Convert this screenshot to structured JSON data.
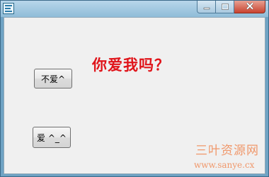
{
  "window": {
    "controls": {
      "minimize_icon": "minimize-icon",
      "maximize_icon": "maximize-icon",
      "close_icon": "close-icon"
    }
  },
  "main": {
    "question": "你爱我吗？",
    "no_button_label": "不爱^",
    "yes_button_label": "爱 ^_^"
  },
  "watermark": {
    "site_name": "三叶资源网",
    "url": "www.sanye.cx"
  },
  "colors": {
    "question": "#e0141a",
    "watermark": "#f0976a",
    "close_button": "#c8432f"
  }
}
